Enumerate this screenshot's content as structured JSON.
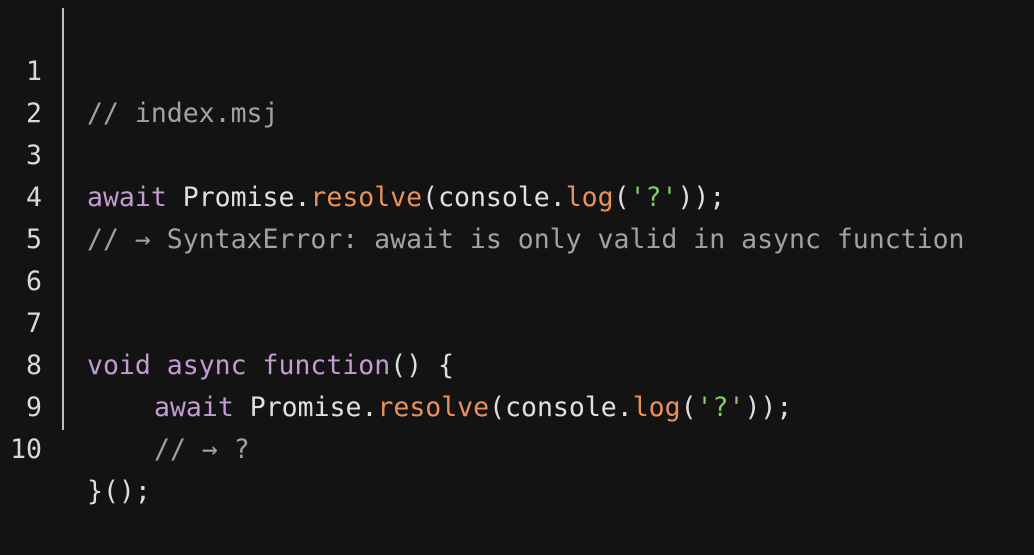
{
  "editor": {
    "line_numbers": [
      "1",
      "2",
      "3",
      "4",
      "5",
      "6",
      "7",
      "8",
      "9",
      "10"
    ],
    "lines": {
      "l1": {
        "comment": "// index.msj"
      },
      "l3": {
        "await": "await",
        "promise": "Promise",
        "dot1": ".",
        "resolve": "resolve",
        "open1": "(",
        "console": "console",
        "dot2": ".",
        "log": "log",
        "open2": "(",
        "string": "'?'",
        "close": "));"
      },
      "l4": {
        "comment": "// → SyntaxError: await is only valid in async function"
      },
      "l7": {
        "void": "void",
        "async": "async",
        "function": "function",
        "parens": "() {"
      },
      "l8": {
        "await": "await",
        "promise": "Promise",
        "dot1": ".",
        "resolve": "resolve",
        "open1": "(",
        "console": "console",
        "dot2": ".",
        "log": "log",
        "open2": "(",
        "string": "'?'",
        "close": "));"
      },
      "l9": {
        "comment": "// → ?"
      },
      "l10": {
        "text": "}();"
      }
    },
    "colors": {
      "background": "#131313",
      "comment": "#a2a2a2",
      "keyword": "#c39ad2",
      "method": "#e9915b",
      "string": "#84c96f",
      "plain": "#e0e0e0",
      "gutter_divider": "#bdbdbd"
    }
  }
}
